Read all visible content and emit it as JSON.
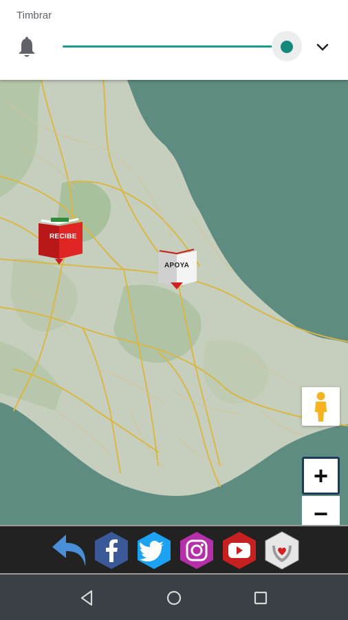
{
  "volume_panel": {
    "label": "Timbrar",
    "level": 1.0,
    "accent_color": "#14887b",
    "bell_icon": "bell-icon",
    "expand_icon": "chevron-down-icon"
  },
  "map": {
    "markers": [
      {
        "label": "RECIBE",
        "color": "#d62020"
      },
      {
        "label": "APOYA",
        "color": "#ffffff"
      }
    ],
    "street_view_icon": "pegman-icon",
    "zoom_in_label": "+",
    "zoom_out_label": "−"
  },
  "social_bar": {
    "items": [
      {
        "name": "back",
        "icon": "back-arrow-icon",
        "color": "#4a90d9"
      },
      {
        "name": "facebook",
        "icon": "facebook-icon",
        "color": "#3b5998"
      },
      {
        "name": "twitter",
        "icon": "twitter-icon",
        "color": "#1da1f2"
      },
      {
        "name": "instagram",
        "icon": "instagram-icon",
        "color": "#b52fa8"
      },
      {
        "name": "youtube",
        "icon": "youtube-icon",
        "color": "#e52d27"
      },
      {
        "name": "heart-hands",
        "icon": "heart-hands-icon",
        "color": "#e0e0e0"
      }
    ]
  },
  "nav_bar": {
    "back_icon": "nav-back-icon",
    "home_icon": "nav-home-icon",
    "recents_icon": "nav-recents-icon"
  }
}
